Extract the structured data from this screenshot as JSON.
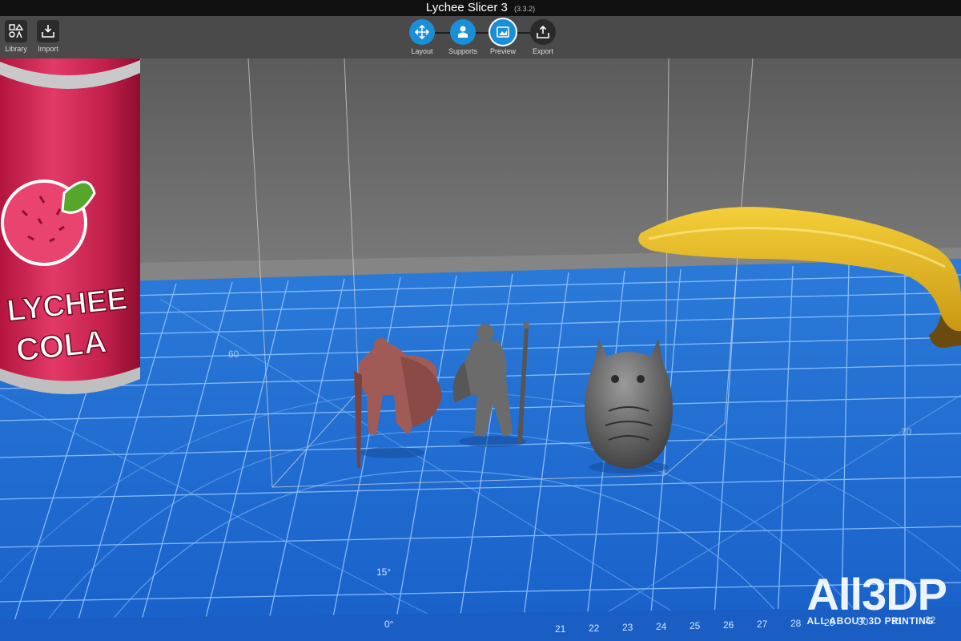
{
  "window": {
    "title": "Lychee Slicer 3",
    "version": "(3.3.2)"
  },
  "toolbar": {
    "left_buttons": [
      {
        "label": "Library",
        "icon": "library-icon"
      },
      {
        "label": "Import",
        "icon": "import-icon"
      }
    ],
    "workflow_steps": [
      {
        "label": "Layout",
        "icon": "layout-icon",
        "active": false
      },
      {
        "label": "Supports",
        "icon": "supports-icon",
        "active": false
      },
      {
        "label": "Preview",
        "icon": "preview-icon",
        "active": true
      },
      {
        "label": "Export",
        "icon": "export-icon",
        "active": false
      }
    ]
  },
  "scene": {
    "can": {
      "text_line1": "LYCHEE",
      "text_line2": "COLA"
    },
    "mat_labels": [
      "15°",
      "0°",
      "60",
      "70",
      "21",
      "22",
      "23",
      "24",
      "25",
      "26",
      "27",
      "28",
      "29",
      "30",
      "31",
      "32"
    ]
  },
  "watermark": {
    "logo": "All3DP",
    "tagline": "ALL ABOUT 3D PRINTING"
  },
  "colors": {
    "accent": "#1a8fd8",
    "mat": "#1f6fd2",
    "mat_lines": "#8ec4ff",
    "toolbar": "#4a4a4a",
    "backdrop": "#6a6a6a",
    "miniature_red": "#a15b56",
    "miniature_grey": "#6b6b6b"
  }
}
